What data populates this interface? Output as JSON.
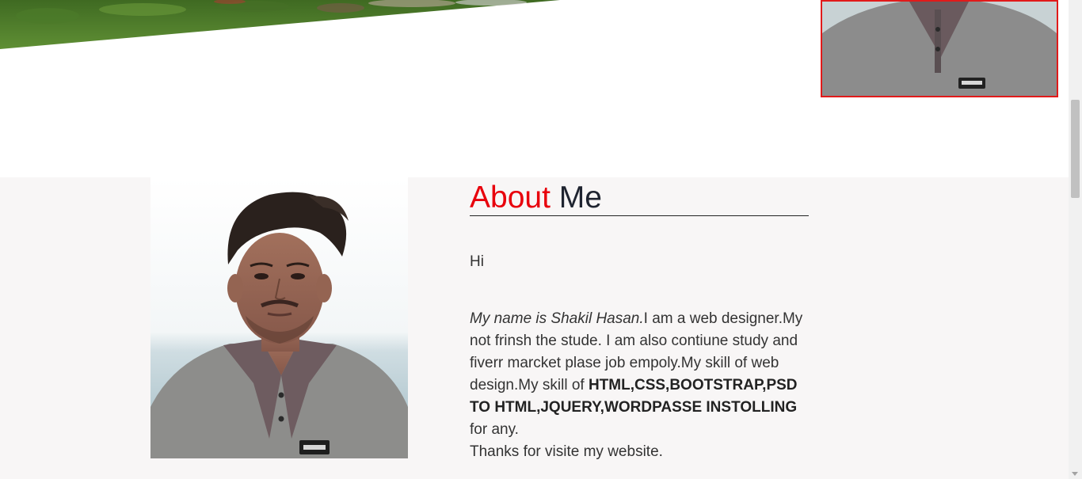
{
  "about": {
    "heading_accent": "About",
    "heading_rest": "Me",
    "greeting": "Hi",
    "bio_intro": "My name is Shakil Hasan.",
    "bio_text_1": "I am a web designer.My not frinsh the stude. I am also contiune study and fiverr marcket plase job empoly.My skill of web design.My skill of ",
    "bio_skills": "HTML,CSS,BOOTSTRAP,PSD TO HTML,JQUERY,WORDPASSE INSTOLLING",
    "bio_text_2": " for any.",
    "bio_closing": "Thanks for visite my website."
  },
  "colors": {
    "accent": "#e8000c",
    "section_bg": "#f8f6f6",
    "thumb_border": "#e11a1a"
  }
}
